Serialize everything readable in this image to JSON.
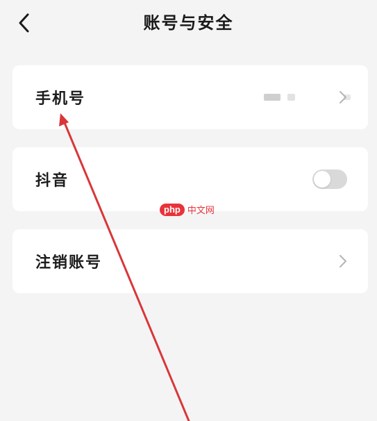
{
  "header": {
    "title": "账号与安全",
    "back_icon": "chevron-left-icon"
  },
  "settings": {
    "phone": {
      "label": "手机号",
      "value_masked": true,
      "chevron_icon": "chevron-right-icon"
    },
    "douyin": {
      "label": "抖音",
      "toggle_on": false
    },
    "deactivate": {
      "label": "注销账号",
      "chevron_icon": "chevron-right-icon"
    }
  },
  "watermark": {
    "badge": "php",
    "text": "中文网"
  },
  "annotation": {
    "type": "arrow",
    "color": "#d9363a"
  },
  "colors": {
    "background": "#f4f4f4",
    "card": "#ffffff",
    "text": "#1c1c1c",
    "toggle_off": "#d9d9d9",
    "arrow": "#d9363a"
  }
}
